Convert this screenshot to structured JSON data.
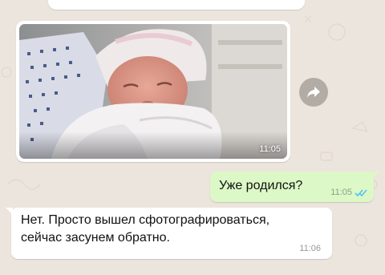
{
  "chat": {
    "photo_message": {
      "time": "11:05"
    },
    "outgoing_message": {
      "text": "Уже родился?",
      "time": "11:05",
      "status_icon": "double-check-read-icon"
    },
    "incoming_message": {
      "line1": "Нет. Просто вышел сфотографироваться,",
      "line2": "сейчас засунем обратно.",
      "time": "11:06"
    },
    "forward_icon": "forward-arrow-icon"
  },
  "colors": {
    "background": "#ece5dd",
    "outgoing_bubble": "#dcf8c6",
    "incoming_bubble": "#ffffff",
    "read_ticks": "#4fc3f7"
  }
}
